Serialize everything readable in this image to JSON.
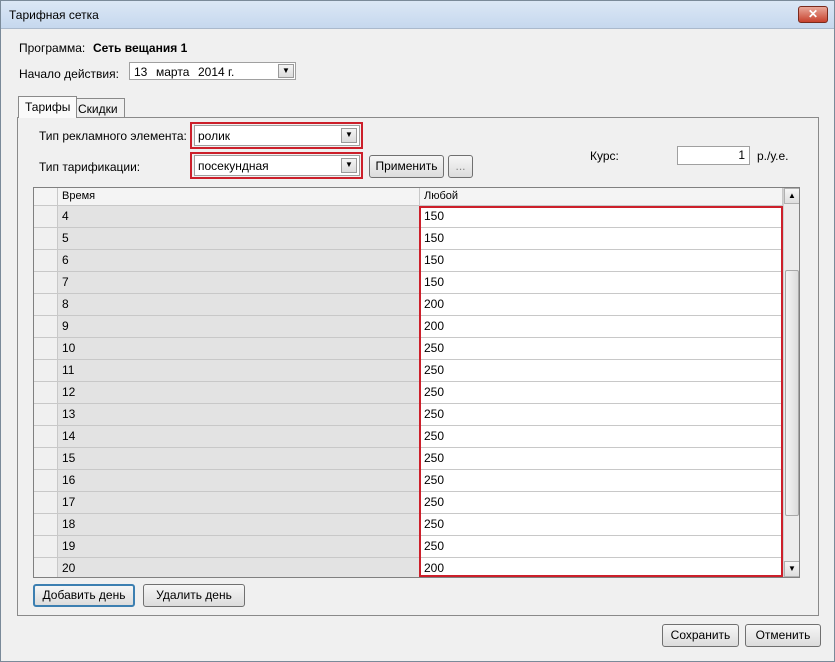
{
  "window": {
    "title": "Тарифная сетка",
    "close_glyph": "✕"
  },
  "program": {
    "label": "Программа:",
    "value": "Сеть вещания 1"
  },
  "start": {
    "label": "Начало действия:",
    "day": "13",
    "month": "марта",
    "year": "2014 г."
  },
  "tabs": [
    {
      "label": "Тарифы",
      "active": true
    },
    {
      "label": "Скидки",
      "active": false
    }
  ],
  "form": {
    "element_type_label": "Тип рекламного элемента:",
    "element_type_value": "ролик",
    "tariff_type_label": "Тип тарификации:",
    "tariff_type_value": "посекундная",
    "apply_label": "Применить",
    "ellipsis_label": "...",
    "rate_label": "Курс:",
    "rate_value": "1",
    "rate_unit": "р./у.е."
  },
  "grid": {
    "columns": [
      "Время",
      "Любой"
    ],
    "rows": [
      {
        "time": "4",
        "any": "150"
      },
      {
        "time": "5",
        "any": "150"
      },
      {
        "time": "6",
        "any": "150"
      },
      {
        "time": "7",
        "any": "150"
      },
      {
        "time": "8",
        "any": "200"
      },
      {
        "time": "9",
        "any": "200"
      },
      {
        "time": "10",
        "any": "250"
      },
      {
        "time": "11",
        "any": "250"
      },
      {
        "time": "12",
        "any": "250"
      },
      {
        "time": "13",
        "any": "250"
      },
      {
        "time": "14",
        "any": "250"
      },
      {
        "time": "15",
        "any": "250"
      },
      {
        "time": "16",
        "any": "250"
      },
      {
        "time": "17",
        "any": "250"
      },
      {
        "time": "18",
        "any": "250"
      },
      {
        "time": "19",
        "any": "250"
      },
      {
        "time": "20",
        "any": "200"
      }
    ]
  },
  "buttons": {
    "add_day": "Добавить день",
    "remove_day": "Удалить день",
    "save": "Сохранить",
    "cancel": "Отменить"
  },
  "icons": {
    "dropdown": "chevron-down-icon",
    "scroll_up": "arrow-up-icon",
    "scroll_down": "arrow-down-icon",
    "close": "close-icon"
  },
  "colors": {
    "highlight": "#cc1f2a",
    "title_bar": "#c6d8ee"
  }
}
